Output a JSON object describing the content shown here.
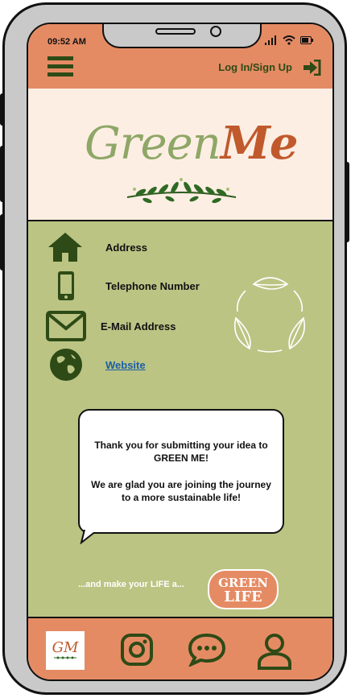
{
  "status_bar": {
    "time": "09:52 AM"
  },
  "header": {
    "login_label": "Log In/Sign Up",
    "menu_icon": "hamburger-menu-icon",
    "login_icon": "sign-in-icon"
  },
  "brand": {
    "logo_green": "Green",
    "logo_me": "Me"
  },
  "contact": {
    "items": [
      {
        "icon": "home-icon",
        "label": "Address"
      },
      {
        "icon": "phone-icon",
        "label": "Telephone Number"
      },
      {
        "icon": "mail-icon",
        "label": "E-Mail Address"
      },
      {
        "icon": "globe-icon",
        "label": "Website"
      }
    ]
  },
  "message": {
    "text": "Thank you for submitting your idea to GREEN ME!\n\nWe are glad you are joining the journey to a more sustainable life!"
  },
  "tagline": {
    "text": "...and make your LIFE a...",
    "badge_line1": "GREEN",
    "badge_line2": "LIFE"
  },
  "footer": {
    "logo_text": "GM",
    "icons": [
      "instagram-icon",
      "chat-icon",
      "profile-icon"
    ]
  },
  "colors": {
    "accent": "#e58b64",
    "body": "#bbc483",
    "banner": "#fdeee3",
    "dark_green": "#2e4a16",
    "logo_green": "#8ea767",
    "logo_orange": "#c05a2d"
  }
}
